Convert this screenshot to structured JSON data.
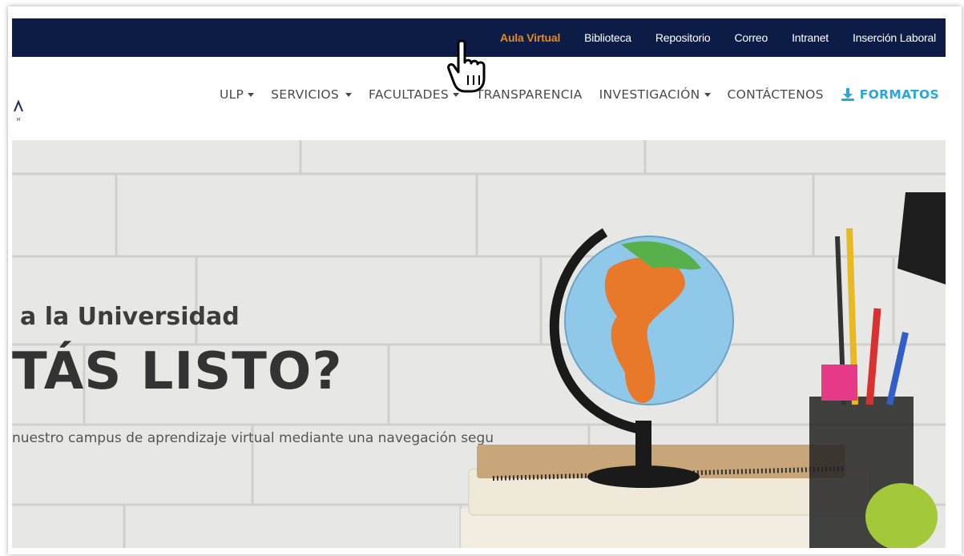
{
  "top_links": [
    {
      "label": "Aula Virtual",
      "active": true
    },
    {
      "label": "Biblioteca",
      "active": false
    },
    {
      "label": "Repositorio",
      "active": false
    },
    {
      "label": "Correo",
      "active": false
    },
    {
      "label": "Intranet",
      "active": false
    },
    {
      "label": "Inserción Laboral",
      "active": false
    }
  ],
  "nav": {
    "items": [
      {
        "label": "ULP",
        "dropdown": true
      },
      {
        "label": "SERVICIOS",
        "dropdown": true
      },
      {
        "label": "FACULTADES",
        "dropdown": true
      },
      {
        "label": "TRANSPARENCIA",
        "dropdown": false
      },
      {
        "label": "INVESTIGACIÓN",
        "dropdown": true
      },
      {
        "label": "CONTÁCTENOS",
        "dropdown": false
      }
    ],
    "formatos_label": "FORMATOS",
    "formatos_icon": "download-icon"
  },
  "hero": {
    "subtitle": "a la Universidad",
    "title": "TÁS LISTO?",
    "description": "nuestro campus de aprendizaje virtual mediante una navegación segu"
  },
  "colors": {
    "topbar_bg": "#0d1c47",
    "active_link": "#e38a1e",
    "formatos": "#2aa6d8",
    "nav_text": "#4a4a4a"
  },
  "icons": [
    "hand-pointer-cursor-icon",
    "download-icon",
    "caret-down-icon"
  ]
}
